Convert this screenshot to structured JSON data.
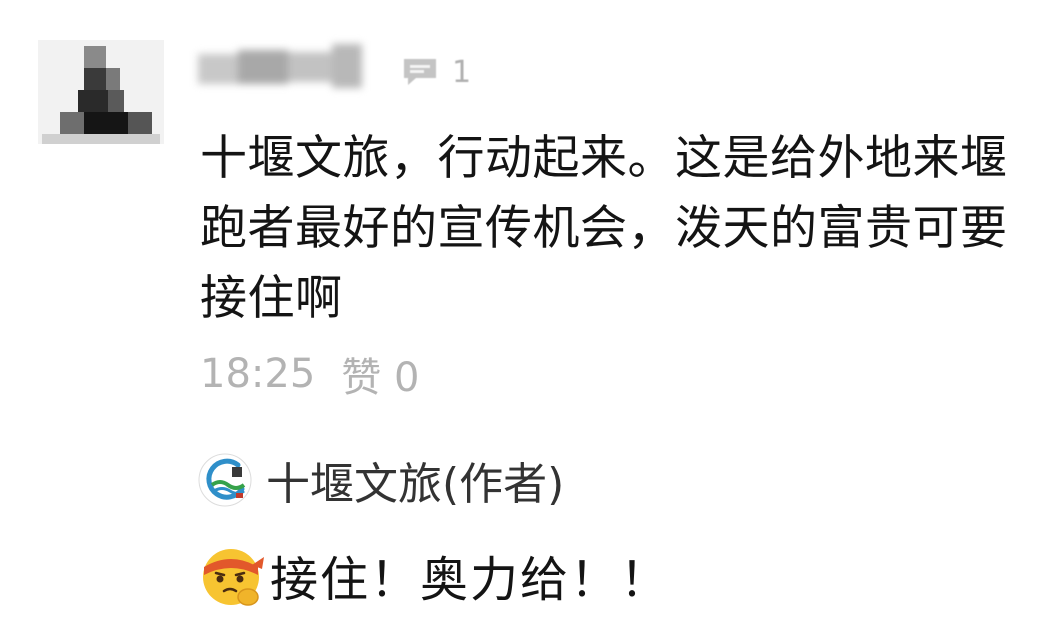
{
  "comment": {
    "reply_count": "1",
    "text": "十堰文旅，行动起来。这是给外地来堰跑者最好的宣传机会，泼天的富贵可要接住啊",
    "time": "18:25",
    "like_label": "赞 0"
  },
  "author_reply": {
    "author": "十堰文旅(作者)",
    "emoji": "saluting-face-emoji",
    "text": "接住！奥力给！！"
  },
  "colors": {
    "meta_gray": "#b3b3b3",
    "text": "#141414"
  }
}
